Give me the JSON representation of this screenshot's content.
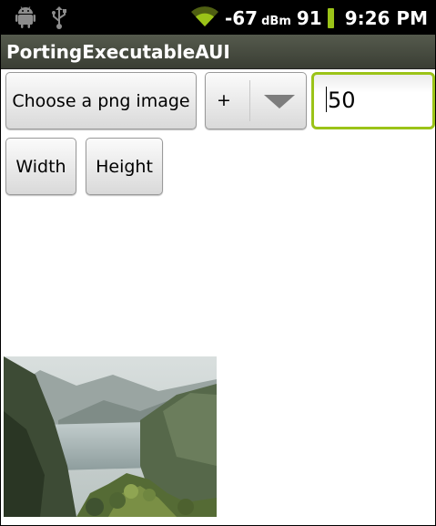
{
  "status_bar": {
    "signal_dbm": "-67",
    "signal_unit": "dBm",
    "battery_level": "91",
    "time": "9:26 PM",
    "icons": [
      "android-icon",
      "usb-icon",
      "wifi-icon",
      "battery-icon"
    ]
  },
  "app": {
    "title": "PortingExecutableAUI"
  },
  "controls": {
    "choose_image_label": "Choose a png image",
    "operator_selected": "+",
    "value_input": "50",
    "width_label": "Width",
    "height_label": "Height"
  },
  "colors": {
    "accent": "#9bc318",
    "title_bar": "#4a4f42",
    "status_bar": "#000000"
  }
}
